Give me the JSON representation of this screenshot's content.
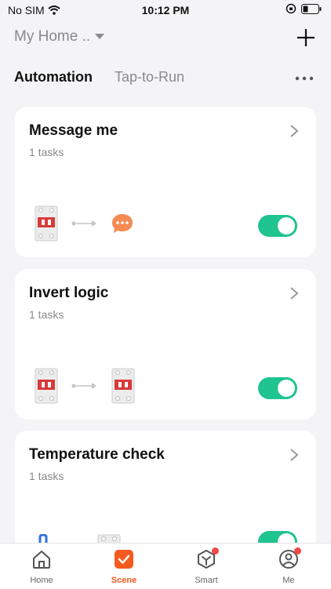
{
  "status_bar": {
    "carrier": "No SIM",
    "time": "10:12 PM"
  },
  "header": {
    "home_name": "My Home .."
  },
  "tabs": {
    "active": "Automation",
    "inactive": "Tap-to-Run"
  },
  "cards": [
    {
      "title": "Message me",
      "subtitle": "1 tasks",
      "enabled": true
    },
    {
      "title": "Invert logic",
      "subtitle": "1 tasks",
      "enabled": true
    },
    {
      "title": "Temperature check",
      "subtitle": "1 tasks",
      "enabled": true
    }
  ],
  "tabbar": {
    "items": [
      "Home",
      "Scene",
      "Smart",
      "Me"
    ],
    "active": "Scene"
  },
  "colors": {
    "accent": "#f55a1e",
    "toggle_on": "#1fc48f",
    "message_icon": "#f58a52",
    "breaker_red": "#d83a3a",
    "badge": "#f04848"
  }
}
